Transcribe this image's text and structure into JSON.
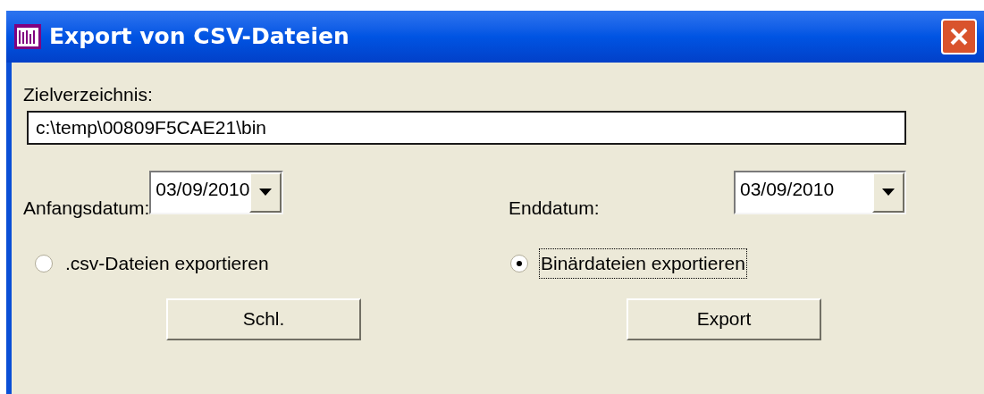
{
  "window": {
    "title": "Export von CSV-Dateien"
  },
  "target_directory": {
    "label": "Zielverzeichnis:",
    "value": "c:\\temp\\00809F5CAE21\\bin"
  },
  "start_date": {
    "label": "Anfangsdatum:",
    "value": "03/09/2010"
  },
  "end_date": {
    "label": "Enddatum:",
    "value": "03/09/2010"
  },
  "export_options": [
    {
      "label": ".csv-Dateien exportieren",
      "selected": false
    },
    {
      "label": "Binärdateien exportieren",
      "selected": true
    }
  ],
  "buttons": [
    "Schl.",
    "Export"
  ]
}
